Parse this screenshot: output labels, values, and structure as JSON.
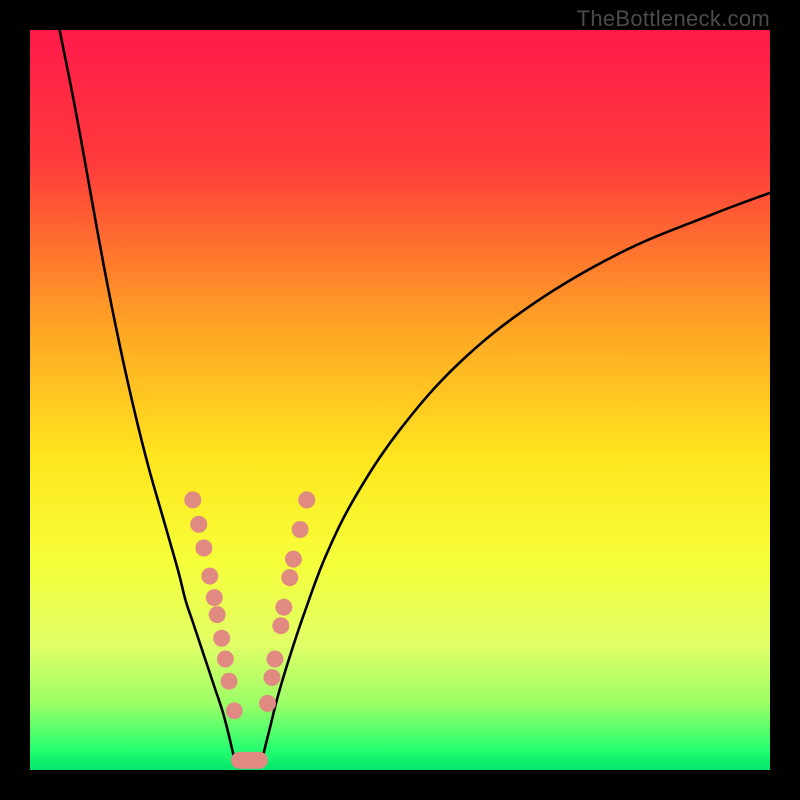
{
  "watermark": "TheBottleneck.com",
  "chart_data": {
    "type": "line",
    "title": "",
    "xlabel": "",
    "ylabel": "",
    "xlim": [
      0,
      100
    ],
    "ylim": [
      0,
      100
    ],
    "gradient_stops": [
      {
        "offset": 0,
        "color": "#ff1a4a"
      },
      {
        "offset": 18,
        "color": "#ff3b3b"
      },
      {
        "offset": 40,
        "color": "#ffa424"
      },
      {
        "offset": 58,
        "color": "#ffe61e"
      },
      {
        "offset": 72,
        "color": "#f5ff3a"
      },
      {
        "offset": 83,
        "color": "#e1ff66"
      },
      {
        "offset": 91,
        "color": "#9cff66"
      },
      {
        "offset": 97,
        "color": "#2aff70"
      },
      {
        "offset": 100,
        "color": "#00e66b"
      }
    ],
    "series": [
      {
        "name": "left-curve",
        "x": [
          4,
          6,
          8,
          10,
          12,
          14,
          16,
          18,
          20,
          21,
          22,
          23,
          24,
          25,
          26,
          26.8,
          27.5
        ],
        "y": [
          100,
          90,
          79,
          68,
          58,
          49,
          41,
          34,
          27,
          23,
          20,
          17,
          14,
          11,
          8,
          5,
          2
        ]
      },
      {
        "name": "right-curve",
        "x": [
          31.5,
          32.5,
          33.5,
          35,
          37,
          40,
          44,
          50,
          58,
          68,
          80,
          92,
          100
        ],
        "y": [
          2,
          6,
          10,
          15,
          21,
          29,
          37,
          46,
          55,
          63,
          70,
          75,
          78
        ]
      },
      {
        "name": "floor-segment",
        "x": [
          27.5,
          31.5
        ],
        "y": [
          1.3,
          1.3
        ]
      }
    ],
    "markers_left": [
      {
        "x": 22.0,
        "y": 36.5
      },
      {
        "x": 22.8,
        "y": 33.2
      },
      {
        "x": 23.5,
        "y": 30.0
      },
      {
        "x": 24.3,
        "y": 26.2
      },
      {
        "x": 24.9,
        "y": 23.3
      },
      {
        "x": 25.3,
        "y": 21.0
      },
      {
        "x": 25.9,
        "y": 17.8
      },
      {
        "x": 26.4,
        "y": 15.0
      },
      {
        "x": 26.9,
        "y": 12.0
      },
      {
        "x": 27.6,
        "y": 8.0
      }
    ],
    "markers_right": [
      {
        "x": 32.1,
        "y": 9.0
      },
      {
        "x": 32.7,
        "y": 12.5
      },
      {
        "x": 33.1,
        "y": 15.0
      },
      {
        "x": 33.9,
        "y": 19.5
      },
      {
        "x": 34.3,
        "y": 22.0
      },
      {
        "x": 35.1,
        "y": 26.0
      },
      {
        "x": 35.6,
        "y": 28.5
      },
      {
        "x": 36.5,
        "y": 32.5
      },
      {
        "x": 37.4,
        "y": 36.5
      }
    ],
    "markers_bottom": [
      {
        "x": 28.3,
        "y": 1.3
      },
      {
        "x": 29.2,
        "y": 1.3
      },
      {
        "x": 30.1,
        "y": 1.3
      },
      {
        "x": 31.0,
        "y": 1.3
      }
    ]
  }
}
